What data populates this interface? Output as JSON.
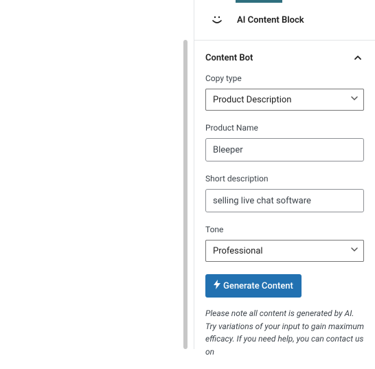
{
  "header": {
    "title": "AI Content Block"
  },
  "panel": {
    "title": "Content Bot"
  },
  "fields": {
    "copy_type": {
      "label": "Copy type",
      "value": "Product Description"
    },
    "product_name": {
      "label": "Product Name",
      "value": "Bleeper"
    },
    "short_description": {
      "label": "Short description",
      "value": "selling live chat software"
    },
    "tone": {
      "label": "Tone",
      "value": "Professional"
    }
  },
  "actions": {
    "generate": "Generate Content"
  },
  "note": "Please note all content is generated by AI. Try variations of your input to gain maximum efficacy. If you need help, you can contact us on"
}
